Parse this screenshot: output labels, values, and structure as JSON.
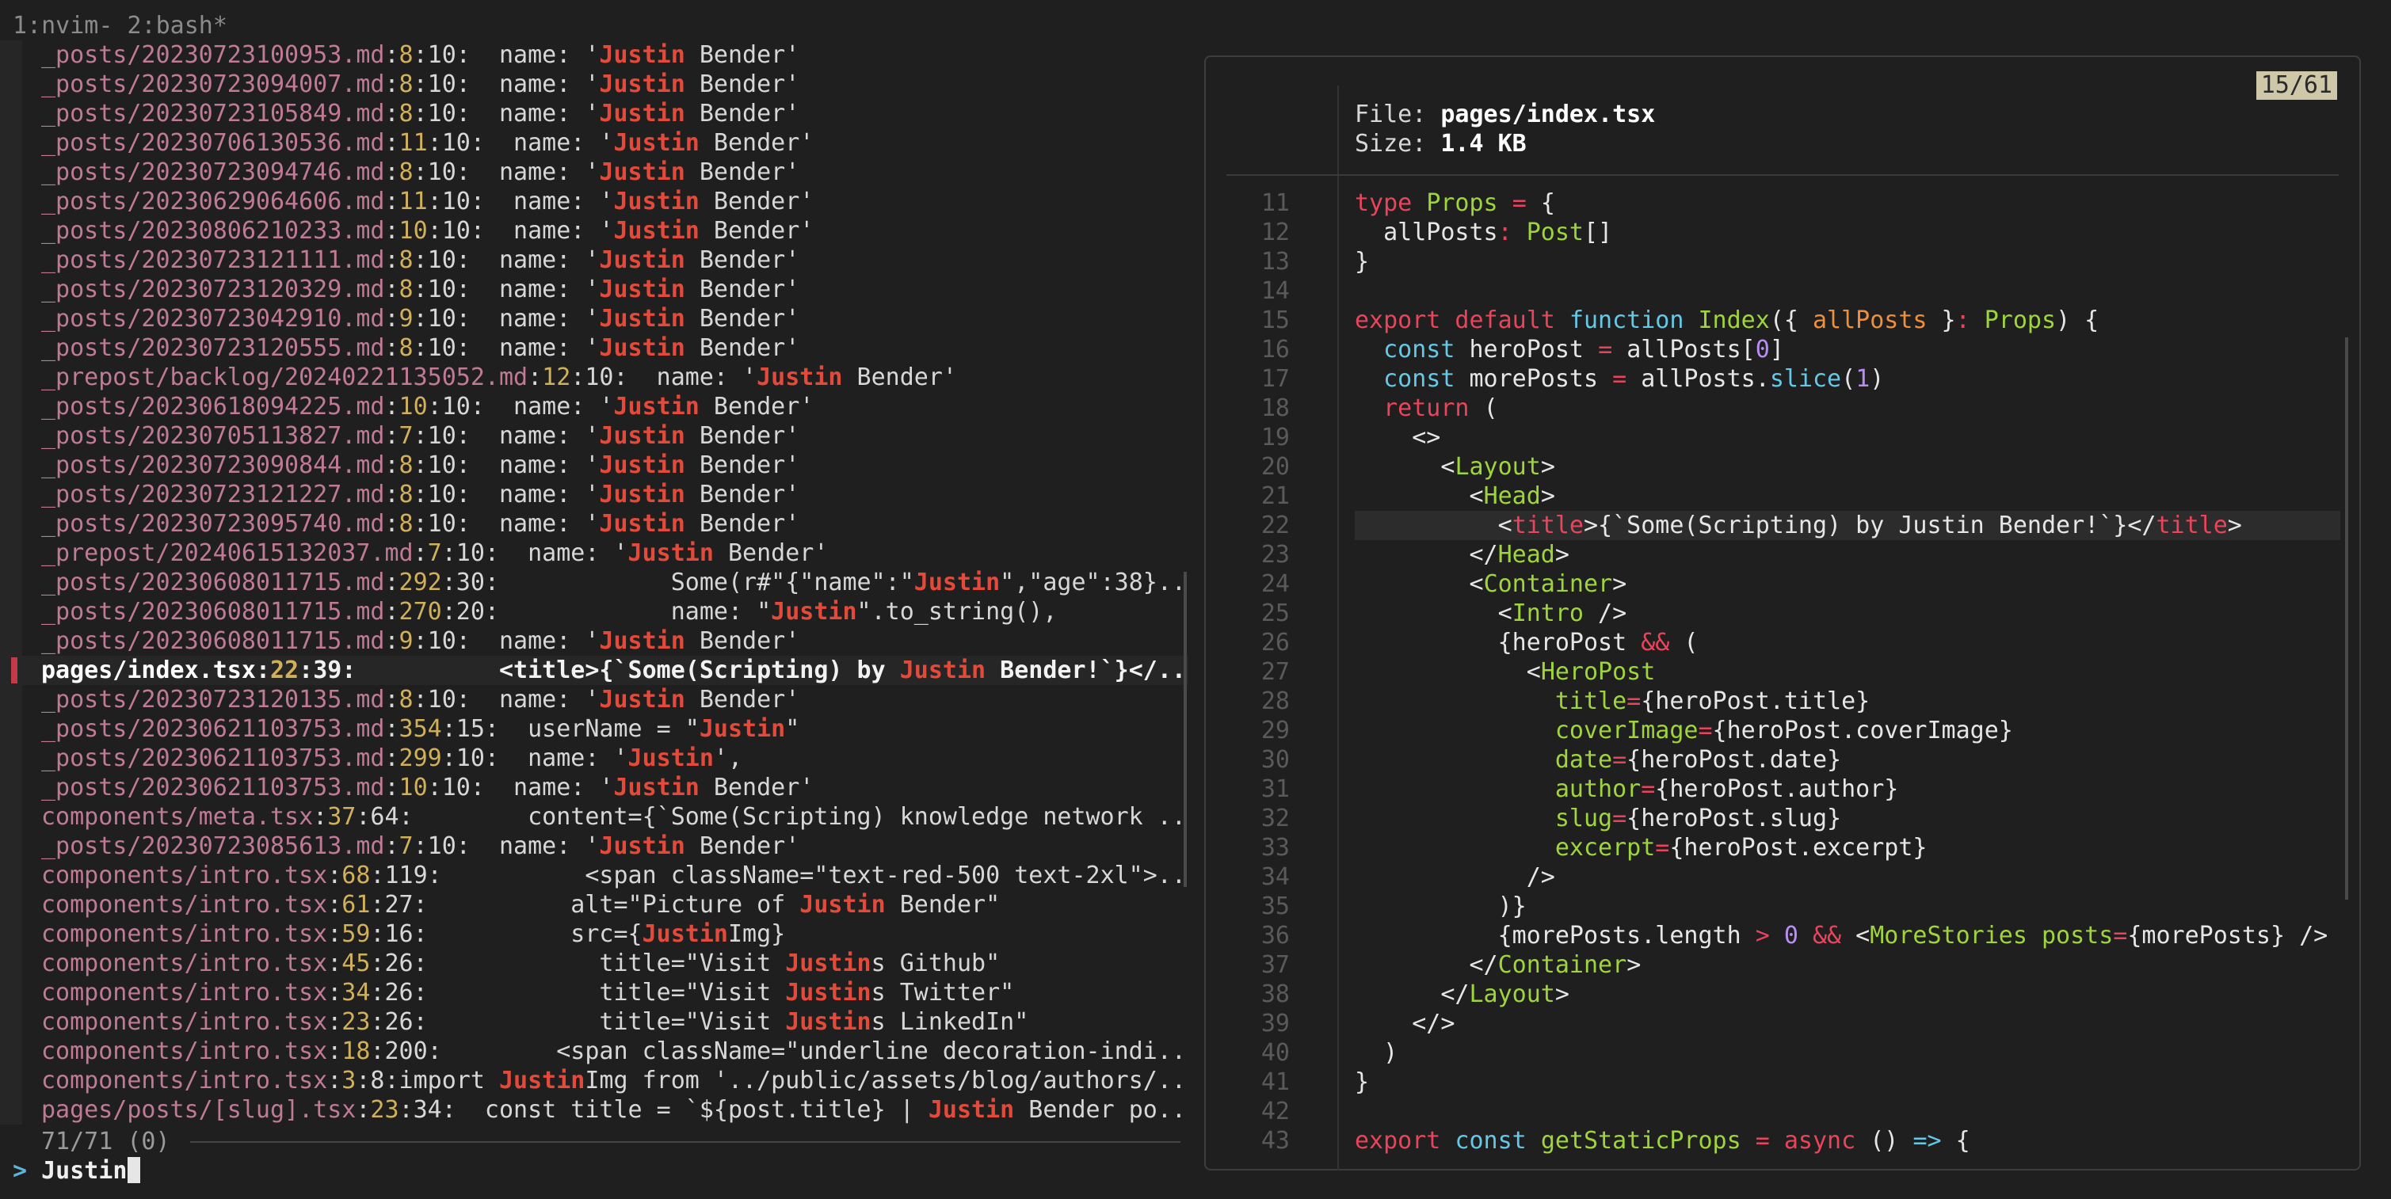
{
  "tabline": "1:nvim- 2:bash*",
  "results": [
    {
      "f": "_posts/20230723100953.md",
      "l": "8",
      "c": "10",
      "pre": ":  name: '",
      "m": "Justin",
      "post": " Bender'"
    },
    {
      "f": "_posts/20230723094007.md",
      "l": "8",
      "c": "10",
      "pre": ":  name: '",
      "m": "Justin",
      "post": " Bender'"
    },
    {
      "f": "_posts/20230723105849.md",
      "l": "8",
      "c": "10",
      "pre": ":  name: '",
      "m": "Justin",
      "post": " Bender'"
    },
    {
      "f": "_posts/20230706130536.md",
      "l": "11",
      "c": "10",
      "pre": ":  name: '",
      "m": "Justin",
      "post": " Bender'"
    },
    {
      "f": "_posts/20230723094746.md",
      "l": "8",
      "c": "10",
      "pre": ":  name: '",
      "m": "Justin",
      "post": " Bender'"
    },
    {
      "f": "_posts/20230629064606.md",
      "l": "11",
      "c": "10",
      "pre": ":  name: '",
      "m": "Justin",
      "post": " Bender'"
    },
    {
      "f": "_posts/20230806210233.md",
      "l": "10",
      "c": "10",
      "pre": ":  name: '",
      "m": "Justin",
      "post": " Bender'"
    },
    {
      "f": "_posts/20230723121111.md",
      "l": "8",
      "c": "10",
      "pre": ":  name: '",
      "m": "Justin",
      "post": " Bender'"
    },
    {
      "f": "_posts/20230723120329.md",
      "l": "8",
      "c": "10",
      "pre": ":  name: '",
      "m": "Justin",
      "post": " Bender'"
    },
    {
      "f": "_posts/20230723042910.md",
      "l": "9",
      "c": "10",
      "pre": ":  name: '",
      "m": "Justin",
      "post": " Bender'"
    },
    {
      "f": "_posts/20230723120555.md",
      "l": "8",
      "c": "10",
      "pre": ":  name: '",
      "m": "Justin",
      "post": " Bender'"
    },
    {
      "f": "_prepost/backlog/20240221135052.md",
      "l": "12",
      "c": "10",
      "pre": ":  name: '",
      "m": "Justin",
      "post": " Bender'"
    },
    {
      "f": "_posts/20230618094225.md",
      "l": "10",
      "c": "10",
      "pre": ":  name: '",
      "m": "Justin",
      "post": " Bender'"
    },
    {
      "f": "_posts/20230705113827.md",
      "l": "7",
      "c": "10",
      "pre": ":  name: '",
      "m": "Justin",
      "post": " Bender'"
    },
    {
      "f": "_posts/20230723090844.md",
      "l": "8",
      "c": "10",
      "pre": ":  name: '",
      "m": "Justin",
      "post": " Bender'"
    },
    {
      "f": "_posts/20230723121227.md",
      "l": "8",
      "c": "10",
      "pre": ":  name: '",
      "m": "Justin",
      "post": " Bender'"
    },
    {
      "f": "_posts/20230723095740.md",
      "l": "8",
      "c": "10",
      "pre": ":  name: '",
      "m": "Justin",
      "post": " Bender'"
    },
    {
      "f": "_prepost/20240615132037.md",
      "l": "7",
      "c": "10",
      "pre": ":  name: '",
      "m": "Justin",
      "post": " Bender'"
    },
    {
      "f": "_posts/20230608011715.md",
      "l": "292",
      "c": "30",
      "pre": ":            Some(r#\"{\"name\":\"",
      "m": "Justin",
      "post": "\",\"age\":38}.."
    },
    {
      "f": "_posts/20230608011715.md",
      "l": "270",
      "c": "20",
      "pre": ":            name: \"",
      "m": "Justin",
      "post": "\".to_string(),"
    },
    {
      "f": "_posts/20230608011715.md",
      "l": "9",
      "c": "10",
      "pre": ":  name: '",
      "m": "Justin",
      "post": " Bender'"
    },
    {
      "f": "pages/index.tsx",
      "l": "22",
      "c": "39",
      "pre": ":          <title>{`Some(Scripting) by ",
      "m": "Justin",
      "post": " Bender!`}</..",
      "selected": true
    },
    {
      "f": "_posts/20230723120135.md",
      "l": "8",
      "c": "10",
      "pre": ":  name: '",
      "m": "Justin",
      "post": " Bender'"
    },
    {
      "f": "_posts/20230621103753.md",
      "l": "354",
      "c": "15",
      "pre": ":  userName = \"",
      "m": "Justin",
      "post": "\""
    },
    {
      "f": "_posts/20230621103753.md",
      "l": "299",
      "c": "10",
      "pre": ":  name: '",
      "m": "Justin",
      "post": "',"
    },
    {
      "f": "_posts/20230621103753.md",
      "l": "10",
      "c": "10",
      "pre": ":  name: '",
      "m": "Justin",
      "post": " Bender'"
    },
    {
      "f": "components/meta.tsx",
      "l": "37",
      "c": "64",
      "pre": ":        content={`Some(Scripting) knowledge network ..",
      "m": "",
      "post": ""
    },
    {
      "f": "_posts/20230723085613.md",
      "l": "7",
      "c": "10",
      "pre": ":  name: '",
      "m": "Justin",
      "post": " Bender'"
    },
    {
      "f": "components/intro.tsx",
      "l": "68",
      "c": "119",
      "pre": ":          <span className=\"text-red-500 text-2xl\">..",
      "m": "",
      "post": ""
    },
    {
      "f": "components/intro.tsx",
      "l": "61",
      "c": "27",
      "pre": ":          alt=\"Picture of ",
      "m": "Justin",
      "post": " Bender\""
    },
    {
      "f": "components/intro.tsx",
      "l": "59",
      "c": "16",
      "pre": ":          src={",
      "m": "Justin",
      "post": "Img}"
    },
    {
      "f": "components/intro.tsx",
      "l": "45",
      "c": "26",
      "pre": ":            title=\"Visit ",
      "m": "Justin",
      "post": "s Github\""
    },
    {
      "f": "components/intro.tsx",
      "l": "34",
      "c": "26",
      "pre": ":            title=\"Visit ",
      "m": "Justin",
      "post": "s Twitter\""
    },
    {
      "f": "components/intro.tsx",
      "l": "23",
      "c": "26",
      "pre": ":            title=\"Visit ",
      "m": "Justin",
      "post": "s LinkedIn\""
    },
    {
      "f": "components/intro.tsx",
      "l": "18",
      "c": "200",
      "pre": ":        <span className=\"underline decoration-indi..",
      "m": "",
      "post": ""
    },
    {
      "f": "components/intro.tsx",
      "l": "3",
      "c": "8",
      "pre": ":import ",
      "m": "Justin",
      "post": "Img from '../public/assets/blog/authors/.."
    },
    {
      "f": "pages/posts/[slug].tsx",
      "l": "23",
      "c": "34",
      "pre": ":  const title = `${post.title} | ",
      "m": "Justin",
      "post": " Bender po.."
    }
  ],
  "counter": "71/71 (0)",
  "prompt": {
    "caret": ">",
    "query": "Justin"
  },
  "preview": {
    "position": "15/61",
    "file_label": "File:",
    "file_value": "pages/index.tsx",
    "size_label": "Size:",
    "size_value": "1.4 KB",
    "current_line": "22",
    "lines": [
      {
        "n": "11",
        "t": [
          [
            "kw",
            "type "
          ],
          [
            "ty",
            "Props "
          ],
          [
            "op",
            "= "
          ],
          [
            "tx",
            "{"
          ]
        ]
      },
      {
        "n": "12",
        "t": [
          [
            "tx",
            "  allPosts"
          ],
          [
            "op",
            ": "
          ],
          [
            "ty",
            "Post"
          ],
          [
            "tx",
            "[]"
          ]
        ]
      },
      {
        "n": "13",
        "t": [
          [
            "tx",
            "}"
          ]
        ]
      },
      {
        "n": "14",
        "t": []
      },
      {
        "n": "15",
        "t": [
          [
            "kw",
            "export default "
          ],
          [
            "fn",
            "function "
          ],
          [
            "ty",
            "Index"
          ],
          [
            "tx",
            "({ "
          ],
          [
            "pm",
            "allPosts"
          ],
          [
            "tx",
            " }"
          ],
          [
            "op",
            ": "
          ],
          [
            "ty",
            "Props"
          ],
          [
            "tx",
            ") {"
          ]
        ]
      },
      {
        "n": "16",
        "t": [
          [
            "fn",
            "  const "
          ],
          [
            "tx",
            "heroPost "
          ],
          [
            "op",
            "= "
          ],
          [
            "tx",
            "allPosts["
          ],
          [
            "nm",
            "0"
          ],
          [
            "tx",
            "]"
          ]
        ]
      },
      {
        "n": "17",
        "t": [
          [
            "fn",
            "  const "
          ],
          [
            "tx",
            "morePosts "
          ],
          [
            "op",
            "= "
          ],
          [
            "tx",
            "allPosts."
          ],
          [
            "fn",
            "slice"
          ],
          [
            "tx",
            "("
          ],
          [
            "nm",
            "1"
          ],
          [
            "tx",
            ")"
          ]
        ]
      },
      {
        "n": "18",
        "t": [
          [
            "kw",
            "  return "
          ],
          [
            "tx",
            "("
          ]
        ]
      },
      {
        "n": "19",
        "t": [
          [
            "tx",
            "    <>"
          ]
        ]
      },
      {
        "n": "20",
        "t": [
          [
            "tx",
            "      <"
          ],
          [
            "tg",
            "Layout"
          ],
          [
            "tx",
            ">"
          ]
        ]
      },
      {
        "n": "21",
        "t": [
          [
            "tx",
            "        <"
          ],
          [
            "tg",
            "Head"
          ],
          [
            "tx",
            ">"
          ]
        ]
      },
      {
        "n": "22",
        "t": [
          [
            "tx",
            "          <"
          ],
          [
            "kw",
            "title"
          ],
          [
            "tx",
            ">{`Some(Scripting) by Justin Bender!`}</"
          ],
          [
            "kw",
            "title"
          ],
          [
            "tx",
            ">"
          ]
        ]
      },
      {
        "n": "23",
        "t": [
          [
            "tx",
            "        </"
          ],
          [
            "tg",
            "Head"
          ],
          [
            "tx",
            ">"
          ]
        ]
      },
      {
        "n": "24",
        "t": [
          [
            "tx",
            "        <"
          ],
          [
            "tg",
            "Container"
          ],
          [
            "tx",
            ">"
          ]
        ]
      },
      {
        "n": "25",
        "t": [
          [
            "tx",
            "          <"
          ],
          [
            "tg",
            "Intro"
          ],
          [
            "tx",
            " />"
          ]
        ]
      },
      {
        "n": "26",
        "t": [
          [
            "tx",
            "          {heroPost "
          ],
          [
            "op",
            "&& "
          ],
          [
            "tx",
            "("
          ]
        ]
      },
      {
        "n": "27",
        "t": [
          [
            "tx",
            "            <"
          ],
          [
            "tg",
            "HeroPost"
          ]
        ]
      },
      {
        "n": "28",
        "t": [
          [
            "at",
            "              title"
          ],
          [
            "op",
            "="
          ],
          [
            "tx",
            "{heroPost.title}"
          ]
        ]
      },
      {
        "n": "29",
        "t": [
          [
            "at",
            "              coverImage"
          ],
          [
            "op",
            "="
          ],
          [
            "tx",
            "{heroPost.coverImage}"
          ]
        ]
      },
      {
        "n": "30",
        "t": [
          [
            "at",
            "              date"
          ],
          [
            "op",
            "="
          ],
          [
            "tx",
            "{heroPost.date}"
          ]
        ]
      },
      {
        "n": "31",
        "t": [
          [
            "at",
            "              author"
          ],
          [
            "op",
            "="
          ],
          [
            "tx",
            "{heroPost.author}"
          ]
        ]
      },
      {
        "n": "32",
        "t": [
          [
            "at",
            "              slug"
          ],
          [
            "op",
            "="
          ],
          [
            "tx",
            "{heroPost.slug}"
          ]
        ]
      },
      {
        "n": "33",
        "t": [
          [
            "at",
            "              excerpt"
          ],
          [
            "op",
            "="
          ],
          [
            "tx",
            "{heroPost.excerpt}"
          ]
        ]
      },
      {
        "n": "34",
        "t": [
          [
            "tx",
            "            />"
          ]
        ]
      },
      {
        "n": "35",
        "t": [
          [
            "tx",
            "          )}"
          ]
        ]
      },
      {
        "n": "36",
        "t": [
          [
            "tx",
            "          {morePosts.length "
          ],
          [
            "op",
            "> "
          ],
          [
            "nm",
            "0 "
          ],
          [
            "op",
            "&& "
          ],
          [
            "tx",
            "<"
          ],
          [
            "tg",
            "MoreStories "
          ],
          [
            "at",
            "posts"
          ],
          [
            "op",
            "="
          ],
          [
            "tx",
            "{morePosts} />"
          ]
        ]
      },
      {
        "n": "37",
        "t": [
          [
            "tx",
            "        </"
          ],
          [
            "tg",
            "Container"
          ],
          [
            "tx",
            ">"
          ]
        ]
      },
      {
        "n": "38",
        "t": [
          [
            "tx",
            "      </"
          ],
          [
            "tg",
            "Layout"
          ],
          [
            "tx",
            ">"
          ]
        ]
      },
      {
        "n": "39",
        "t": [
          [
            "tx",
            "    </>"
          ]
        ]
      },
      {
        "n": "40",
        "t": [
          [
            "tx",
            "  )"
          ]
        ]
      },
      {
        "n": "41",
        "t": [
          [
            "tx",
            "}"
          ]
        ]
      },
      {
        "n": "42",
        "t": []
      },
      {
        "n": "43",
        "t": [
          [
            "kw",
            "export "
          ],
          [
            "fn",
            "const "
          ],
          [
            "ty",
            "getStaticProps "
          ],
          [
            "op",
            "= "
          ],
          [
            "kw",
            "async "
          ],
          [
            "tx",
            "() "
          ],
          [
            "fn",
            "=> "
          ],
          [
            "tx",
            "{"
          ]
        ]
      }
    ]
  },
  "colors": {
    "background": "#1f1f1f",
    "match_highlight": "#e34a3a",
    "selection_marker": "#c23b48",
    "path": "#c07a95",
    "line_number": "#d0b05a"
  }
}
